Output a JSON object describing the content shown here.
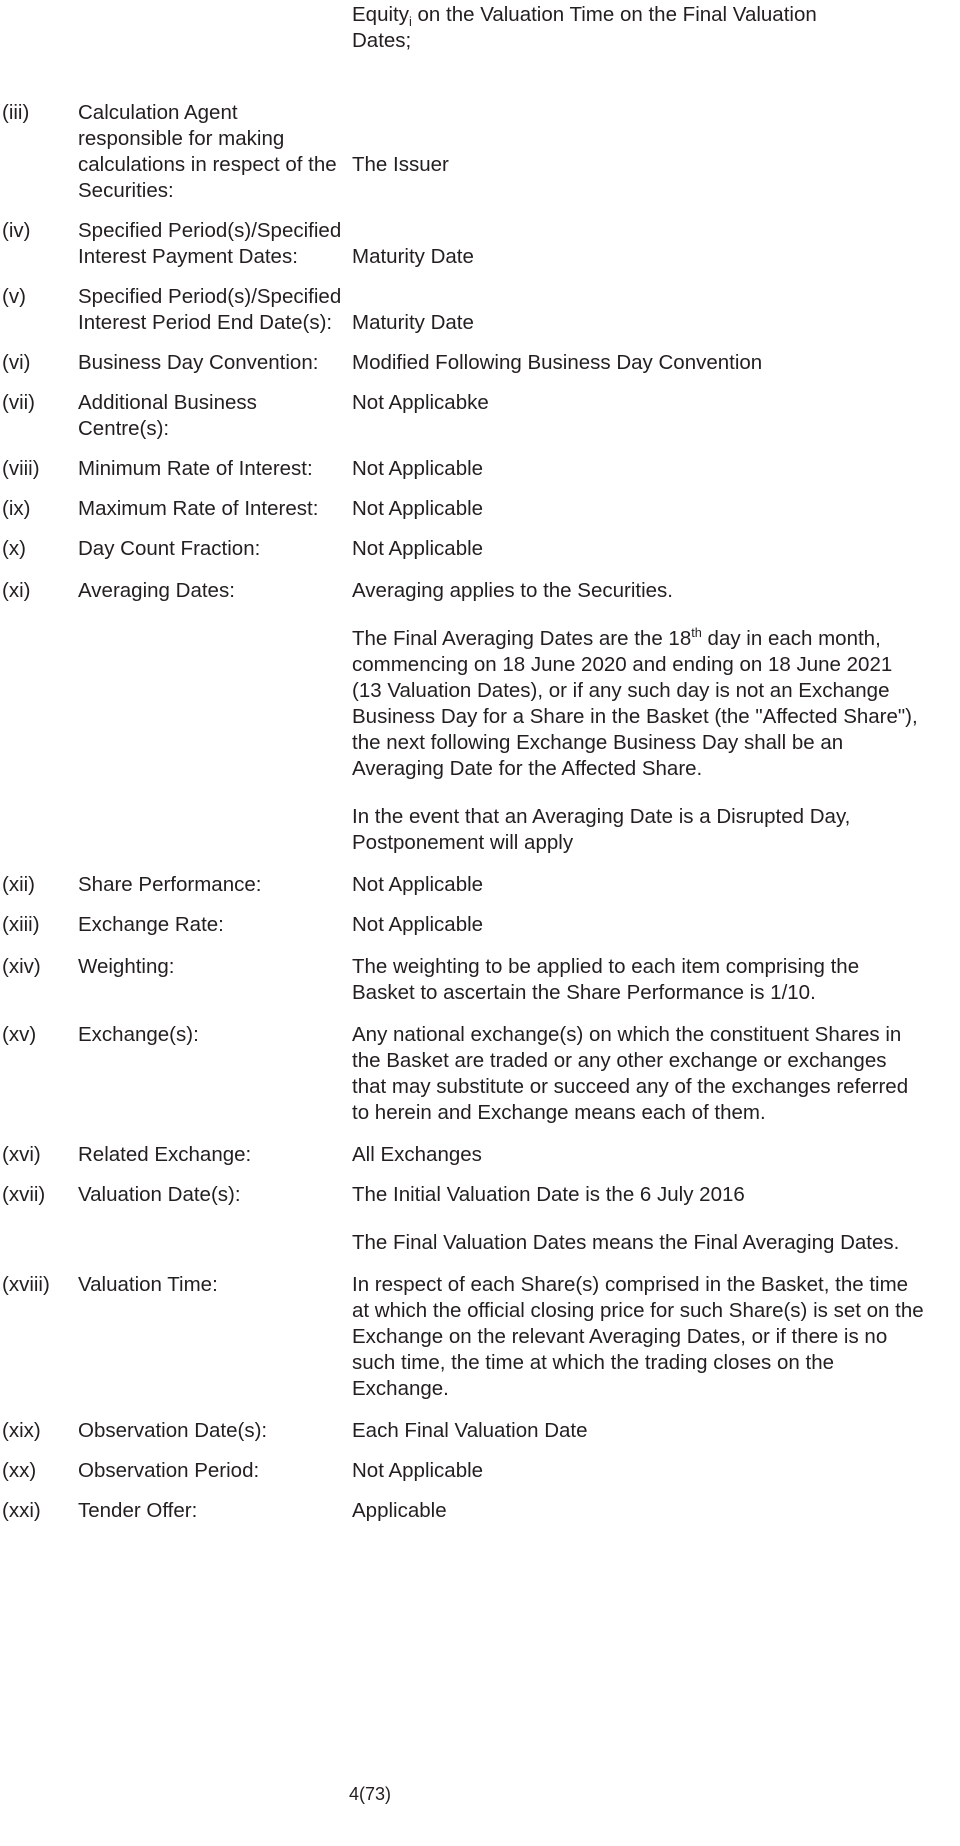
{
  "document": {
    "continuation": {
      "prefix": "Equity",
      "subscript": "i",
      "rest": " on the Valuation Time on the Final Valuation Dates;"
    },
    "footer": "4(73)"
  },
  "rows": [
    {
      "num": "(iii)",
      "label": "Calculation Agent responsible for making calculations in respect of the Securities:",
      "value": "The Issuer"
    },
    {
      "num": "(iv)",
      "label": "Specified Period(s)/Specified Interest Payment Dates:",
      "value": "Maturity Date"
    },
    {
      "num": "(v)",
      "label": "Specified Period(s)/Specified Interest Period End Date(s):",
      "value": "Maturity Date"
    },
    {
      "num": "(vi)",
      "label": "Business Day Convention:",
      "value": "Modified Following Business Day Convention"
    },
    {
      "num": "(vii)",
      "label": "Additional Business Centre(s):",
      "value": "Not Applicabke"
    },
    {
      "num": "(viii)",
      "label": "Minimum Rate of Interest:",
      "value": "Not Applicable"
    },
    {
      "num": "(ix)",
      "label": "Maximum Rate of Interest:",
      "value": "Not Applicable"
    },
    {
      "num": "(x)",
      "label": "Day Count Fraction:",
      "value": "Not Applicable"
    },
    {
      "num": "(xi)",
      "label": "Averaging Dates:",
      "value_p1": "Averaging applies to the Securities.",
      "value_p2_a": "The Final Averaging Dates are the 18",
      "value_p2_sup": "th",
      "value_p2_b": " day in each month, commencing on 18 June 2020 and ending on 18 June 2021 (13 Valuation Dates), or if any such day is not an Exchange Business Day for a Share in the Basket (the \"Affected Share\"), the next following Exchange Business Day shall be an Averaging Date for the Affected Share.",
      "value_p3": "In the event that an Averaging Date is a Disrupted Day, Postponement will apply"
    },
    {
      "num": "(xii)",
      "label": "Share Performance:",
      "value": "Not Applicable"
    },
    {
      "num": "(xiii)",
      "label": "Exchange Rate:",
      "value": "Not Applicable"
    },
    {
      "num": "(xiv)",
      "label": "Weighting:",
      "value": "The weighting to be applied to each item comprising the Basket to ascertain the Share Performance is 1/10."
    },
    {
      "num": "(xv)",
      "label": "Exchange(s):",
      "value": "Any national exchange(s) on which the constituent Shares in the Basket are traded or any other exchange or exchanges that may substitute or succeed any of the exchanges referred to herein and Exchange means each of them."
    },
    {
      "num": "(xvi)",
      "label": "Related Exchange:",
      "value": "All Exchanges"
    },
    {
      "num": "(xvii)",
      "label": "Valuation Date(s):",
      "value_p1": "The Initial Valuation Date is the 6 July 2016",
      "value_p2": "The Final Valuation Dates means the Final Averaging Dates."
    },
    {
      "num": "(xviii)",
      "label": "Valuation Time:",
      "value": "In respect of each Share(s) comprised in the Basket, the time at which the official closing price for such Share(s) is set on the Exchange on the relevant Averaging Dates, or if there is no such time, the time at which the trading closes on the Exchange."
    },
    {
      "num": "(xix)",
      "label": "Observation Date(s):",
      "value": "Each Final Valuation Date"
    },
    {
      "num": "(xx)",
      "label": "Observation Period:",
      "value": "Not Applicable"
    },
    {
      "num": "(xxi)",
      "label": "Tender Offer:",
      "value": "Applicable"
    }
  ]
}
